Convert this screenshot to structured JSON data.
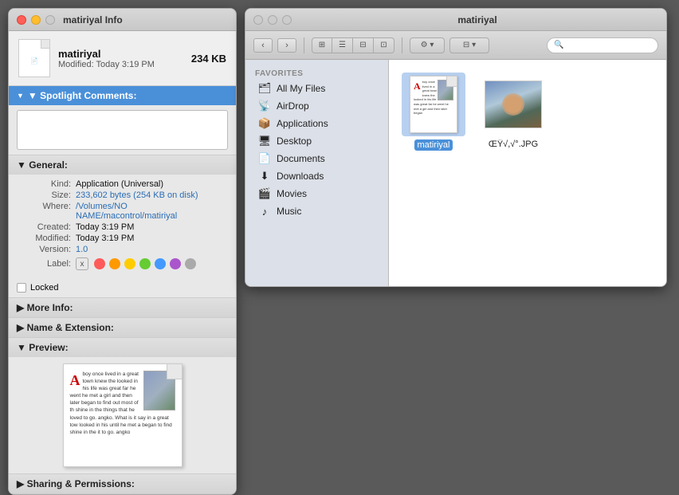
{
  "infoPanel": {
    "title": "matiriyal Info",
    "filename": "matiriyal",
    "modified": "Modified: Today 3:19 PM",
    "size": "234 KB",
    "spotlight": {
      "label": "▼ Spotlight Comments:"
    },
    "general": {
      "label": "▼ General:",
      "kind_label": "Kind:",
      "kind_value": "Application (Universal)",
      "size_label": "Size:",
      "size_value": "233,602 bytes (254 KB on disk)",
      "where_label": "Where:",
      "where_value": "/Volumes/NO NAME/macontrol/matiriyal",
      "created_label": "Created:",
      "created_value": "Today 3:19 PM",
      "modified_label": "Modified:",
      "modified_value": "Today 3:19 PM",
      "version_label": "Version:",
      "version_value": "1.0",
      "label_label": "Label:"
    },
    "locked": {
      "label": "Locked"
    },
    "moreInfo": {
      "label": "▶ More Info:"
    },
    "nameExtension": {
      "label": "▶ Name & Extension:"
    },
    "preview": {
      "label": "▼ Preview:"
    },
    "sharingPermissions": {
      "label": "▶ Sharing & Permissions:"
    }
  },
  "finderWindow": {
    "title": "matiriyal",
    "search_placeholder": "Search",
    "sidebar": {
      "section_label": "FAVORITES",
      "items": [
        {
          "id": "all-my-files",
          "label": "All My Files",
          "icon": "🗂"
        },
        {
          "id": "airdrop",
          "label": "AirDrop",
          "icon": "📡"
        },
        {
          "id": "applications",
          "label": "Applications",
          "icon": "📦"
        },
        {
          "id": "desktop",
          "label": "Desktop",
          "icon": "🖥"
        },
        {
          "id": "documents",
          "label": "Documents",
          "icon": "📄"
        },
        {
          "id": "downloads",
          "label": "Downloads",
          "icon": "⬇"
        },
        {
          "id": "movies",
          "label": "Movies",
          "icon": "🎬"
        },
        {
          "id": "music",
          "label": "Music",
          "icon": "♪"
        }
      ]
    },
    "files": [
      {
        "id": "matiriyal",
        "label": "matiriyal",
        "type": "doc",
        "selected": true
      },
      {
        "id": "img",
        "label": "ŒŸ√,√°.JPG",
        "type": "image",
        "selected": false
      }
    ]
  },
  "colors": {
    "accent": "#4a90d9",
    "red_dot": "#ff5a5a",
    "orange_dot": "#ff9900",
    "yellow_dot": "#ffcc00",
    "green_dot": "#66cc33",
    "blue_dot": "#4499ff",
    "purple_dot": "#aa55cc",
    "gray_dot": "#aaaaaa"
  }
}
